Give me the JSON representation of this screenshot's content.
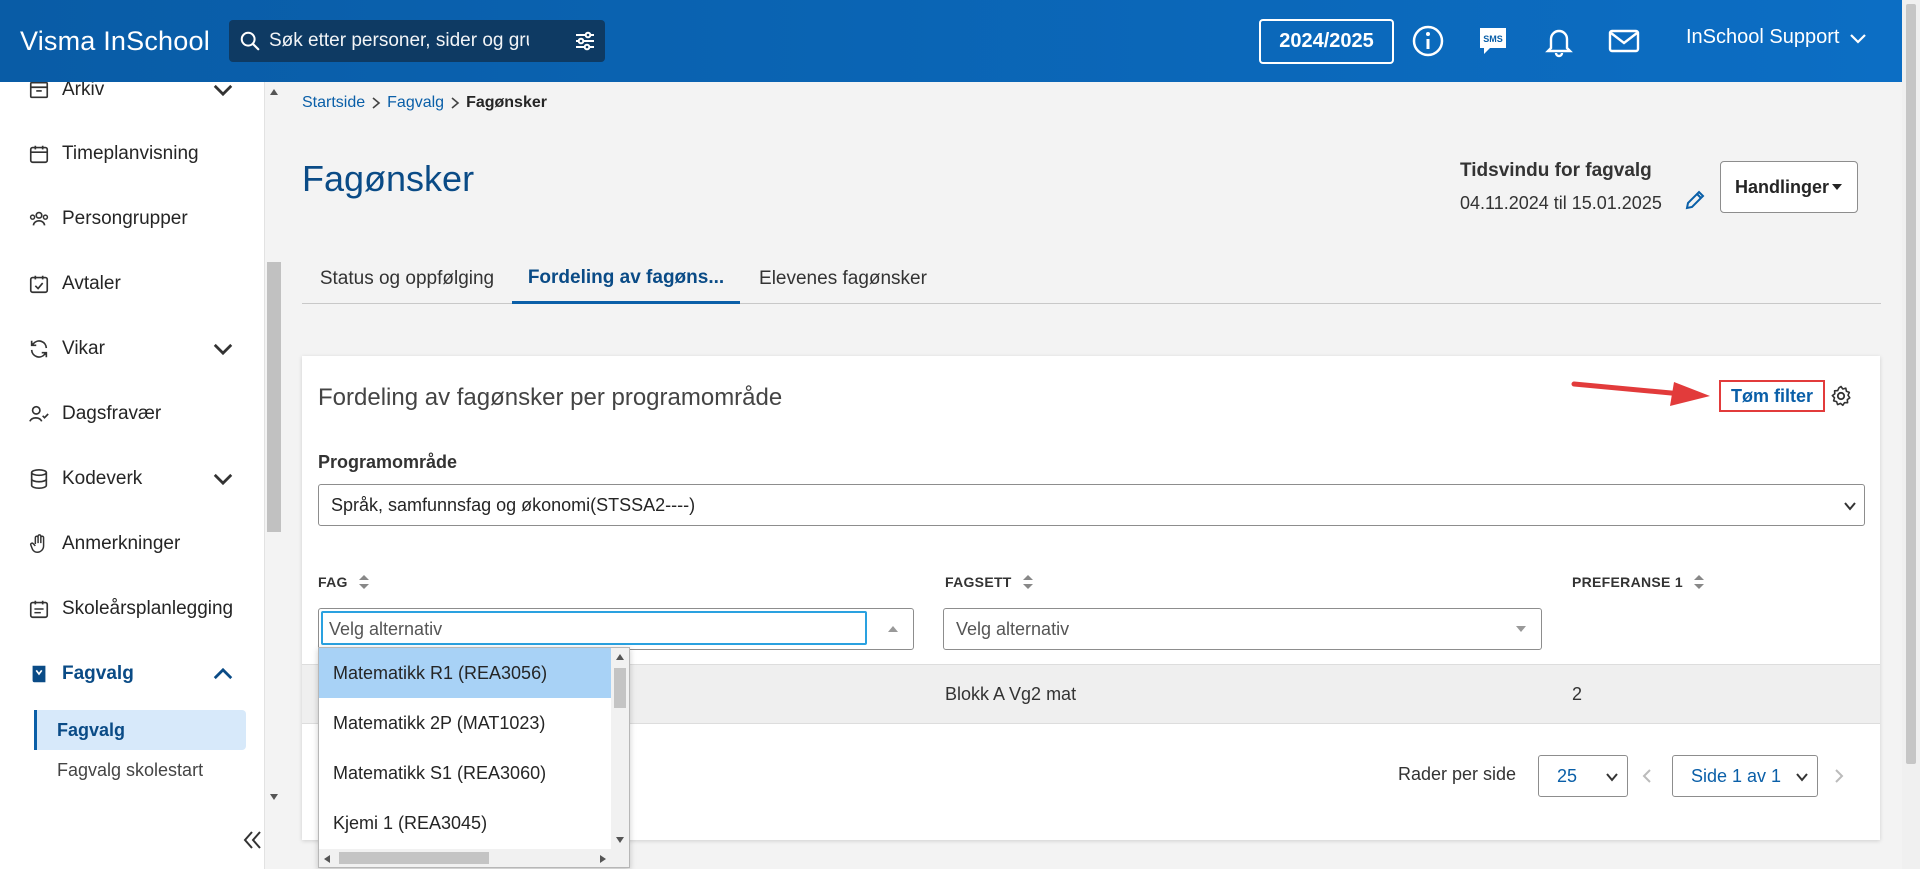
{
  "header": {
    "brand": "Visma InSchool",
    "search_placeholder": "Søk etter personer, sider og grupper",
    "school_year": "2024/2025",
    "user_name": "InSchool Support"
  },
  "sidebar": {
    "items": [
      {
        "label": "Arkiv",
        "icon": "archive-icon",
        "expandable": true
      },
      {
        "label": "Timeplanvisning",
        "icon": "calendar-icon",
        "expandable": false
      },
      {
        "label": "Persongrupper",
        "icon": "people-icon",
        "expandable": false
      },
      {
        "label": "Avtaler",
        "icon": "calendar-check-icon",
        "expandable": false
      },
      {
        "label": "Vikar",
        "icon": "refresh-icon",
        "expandable": true
      },
      {
        "label": "Dagsfravær",
        "icon": "person-check-icon",
        "expandable": false
      },
      {
        "label": "Kodeverk",
        "icon": "database-icon",
        "expandable": true
      },
      {
        "label": "Anmerkninger",
        "icon": "hand-icon",
        "expandable": false
      },
      {
        "label": "Skoleårsplanlegging",
        "icon": "calendar-list-icon",
        "expandable": false
      },
      {
        "label": "Fagvalg",
        "icon": "book-icon",
        "expandable": true,
        "expanded": true
      }
    ],
    "sub_items": [
      {
        "label": "Fagvalg",
        "selected": true
      },
      {
        "label": "Fagvalg skolestart",
        "selected": false
      }
    ]
  },
  "breadcrumb": {
    "items": [
      "Startside",
      "Fagvalg"
    ],
    "current": "Fagønsker"
  },
  "page": {
    "title": "Fagønsker",
    "time_window_label": "Tidsvindu for fagvalg",
    "time_window_value": "04.11.2024 til 15.01.2025",
    "actions_label": "Handlinger"
  },
  "tabs": [
    {
      "label": "Status og oppfølging",
      "active": false
    },
    {
      "label": "Fordeling av fagøns...",
      "active": true
    },
    {
      "label": "Elevenes fagønsker",
      "active": false
    }
  ],
  "card": {
    "title": "Fordeling av fagønsker per programområde",
    "clear_filter": "Tøm filter",
    "program_label": "Programområde",
    "program_value": "Språk, samfunnsfag og økonomi(STSSA2----)"
  },
  "table": {
    "columns": [
      "FAG",
      "FAGSETT",
      "PREFERANSE 1"
    ],
    "filter_placeholder": "Velg alternativ",
    "rows": [
      {
        "fag": "",
        "fagsett": "Blokk A Vg2 mat",
        "preferanse1": "2"
      }
    ]
  },
  "pagination": {
    "rows_per_page_label": "Rader per side",
    "rows_per_page": "25",
    "page": "Side 1 av 1"
  },
  "dropdown": {
    "options": [
      {
        "label": "Matematikk R1 (REA3056)",
        "highlighted": true
      },
      {
        "label": "Matematikk 2P (MAT1023)",
        "highlighted": false
      },
      {
        "label": "Matematikk S1 (REA3060)",
        "highlighted": false
      },
      {
        "label": "Kjemi 1 (REA3045)",
        "highlighted": false
      }
    ]
  },
  "colors": {
    "header_bg": "#0a5fa8",
    "accent": "#0a4b86",
    "highlight": "#a8d2f6",
    "annotation_red": "#e23b3b"
  }
}
